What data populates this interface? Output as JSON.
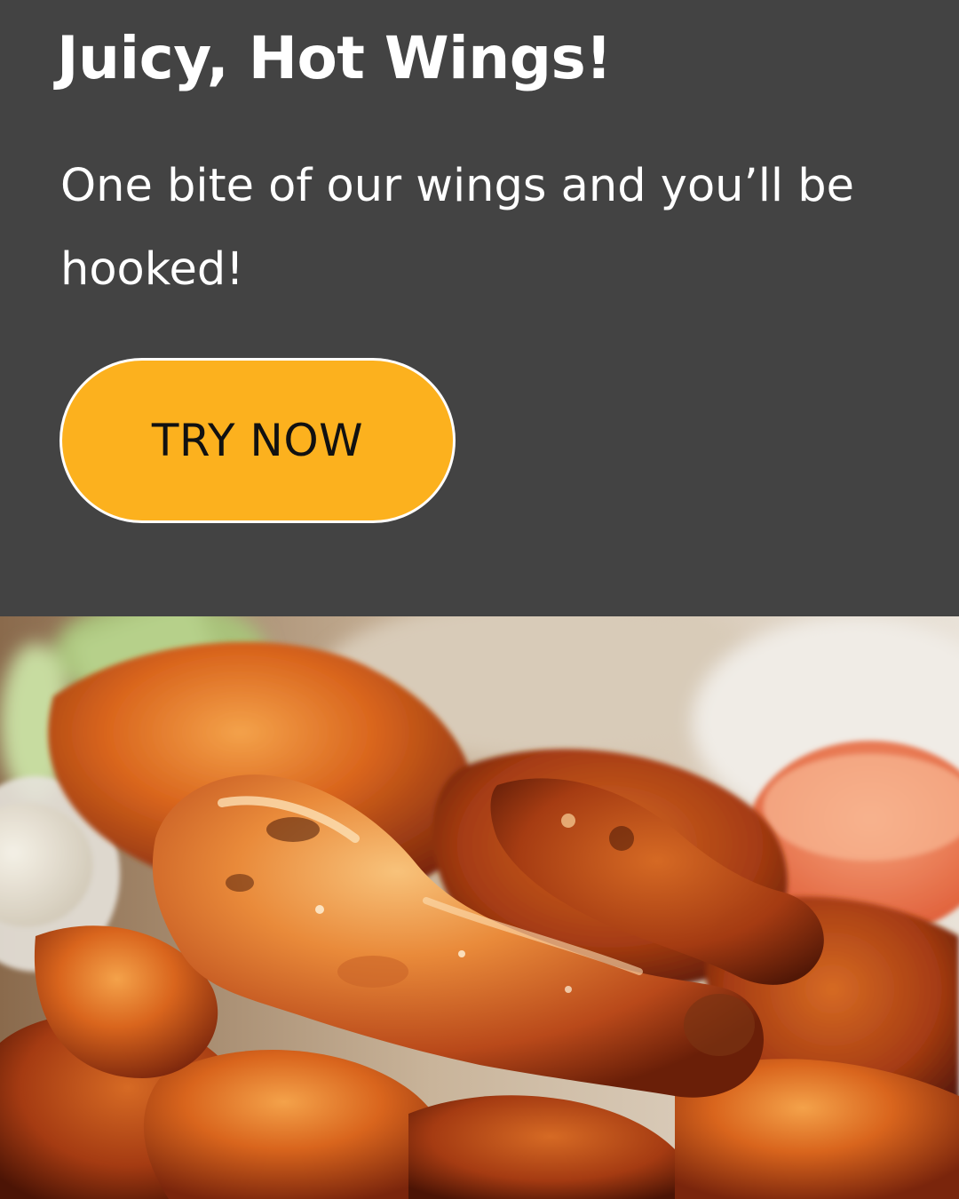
{
  "hero": {
    "title": "Juicy, Hot Wings!",
    "subtitle": "One bite of our wings and you’ll be hooked!",
    "cta_label": "TRY NOW"
  },
  "colors": {
    "background": "#434343",
    "accent": "#fcb11e",
    "text": "#ffffff",
    "button_text": "#111111"
  },
  "photo": {
    "subject": "buffalo-wings-photo"
  }
}
